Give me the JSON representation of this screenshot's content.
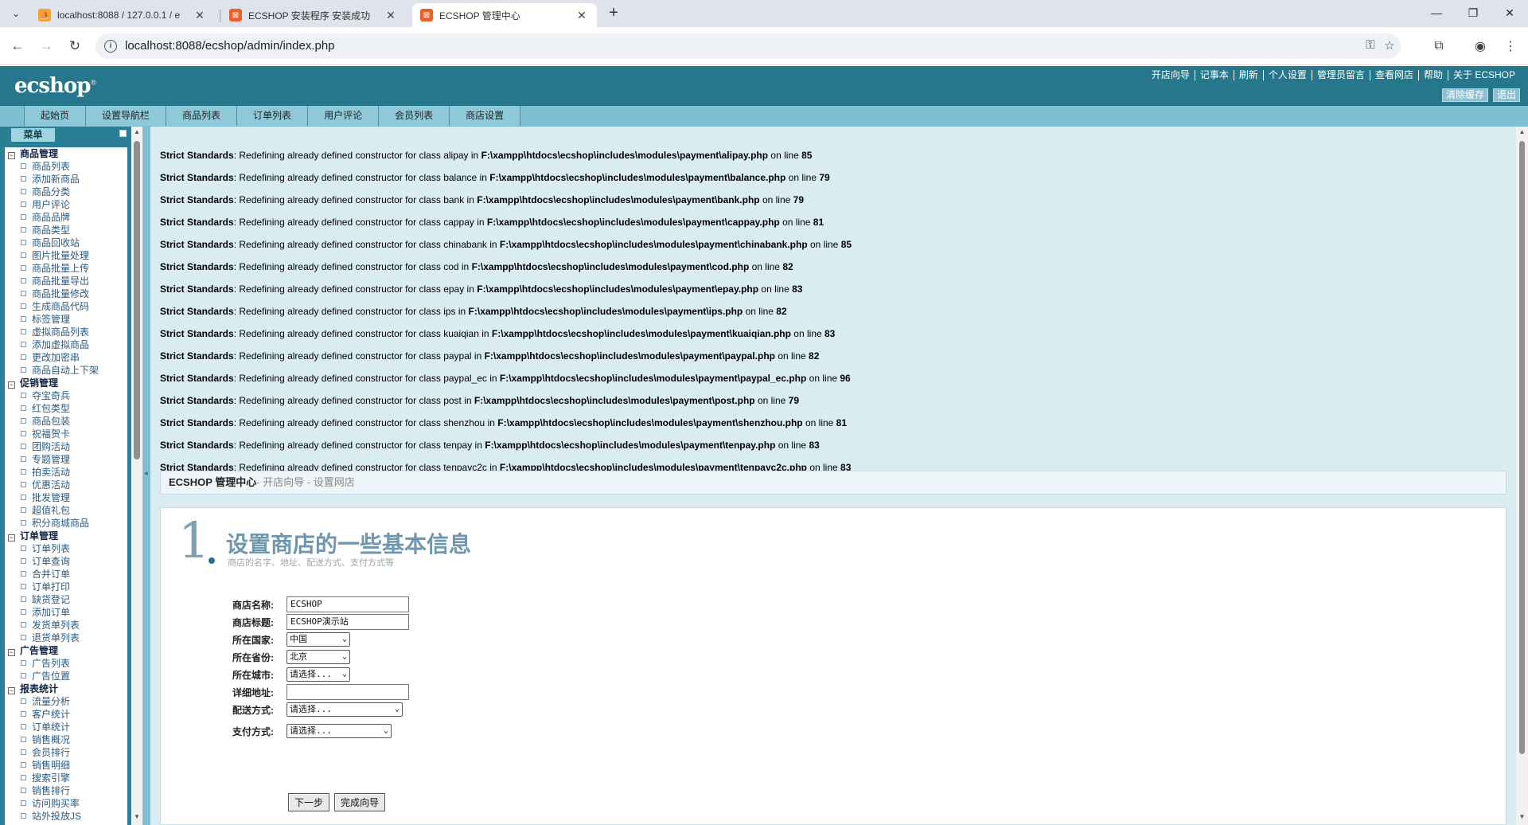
{
  "browser": {
    "tabs": [
      {
        "title": "localhost:8088 / 127.0.0.1 / e",
        "active": false
      },
      {
        "title": "ECSHOP 安装程序 安装成功",
        "active": false
      },
      {
        "title": "ECSHOP 管理中心",
        "active": true
      }
    ],
    "url": "localhost:8088/ecshop/admin/index.php"
  },
  "header": {
    "logo": "ecshop",
    "links": [
      "开店向导",
      "记事本",
      "刷新",
      "个人设置",
      "管理员留言",
      "查看网店",
      "帮助",
      "关于 ECSHOP"
    ],
    "buttons": [
      "清除缓存",
      "退出"
    ]
  },
  "nav": {
    "tabs": [
      "起始页",
      "设置导航栏",
      "商品列表",
      "订单列表",
      "用户评论",
      "会员列表",
      "商店设置"
    ]
  },
  "menu": {
    "title": "菜单",
    "groups": [
      {
        "name": "商品管理",
        "items": [
          "商品列表",
          "添加新商品",
          "商品分类",
          "用户评论",
          "商品品牌",
          "商品类型",
          "商品回收站",
          "图片批量处理",
          "商品批量上传",
          "商品批量导出",
          "商品批量修改",
          "生成商品代码",
          "标签管理",
          "虚拟商品列表",
          "添加虚拟商品",
          "更改加密串",
          "商品自动上下架"
        ]
      },
      {
        "name": "促销管理",
        "items": [
          "夺宝奇兵",
          "红包类型",
          "商品包装",
          "祝福贺卡",
          "团购活动",
          "专题管理",
          "拍卖活动",
          "优惠活动",
          "批发管理",
          "超值礼包",
          "积分商城商品"
        ]
      },
      {
        "name": "订单管理",
        "items": [
          "订单列表",
          "订单查询",
          "合并订单",
          "订单打印",
          "缺货登记",
          "添加订单",
          "发货单列表",
          "退货单列表"
        ]
      },
      {
        "name": "广告管理",
        "items": [
          "广告列表",
          "广告位置"
        ]
      },
      {
        "name": "报表统计",
        "items": [
          "流量分析",
          "客户统计",
          "订单统计",
          "销售概况",
          "会员排行",
          "销售明细",
          "搜索引擎",
          "销售排行",
          "访问购买率",
          "站外投放JS"
        ]
      }
    ]
  },
  "warnings": {
    "label": "Strict Standards",
    "middle": ": Redefining already defined constructor for class ",
    "in": " in ",
    "online": " on line ",
    "rows": [
      {
        "cls": "alipay",
        "file": "F:\\xampp\\htdocs\\ecshop\\includes\\modules\\payment\\alipay.php",
        "line": "85"
      },
      {
        "cls": "balance",
        "file": "F:\\xampp\\htdocs\\ecshop\\includes\\modules\\payment\\balance.php",
        "line": "79"
      },
      {
        "cls": "bank",
        "file": "F:\\xampp\\htdocs\\ecshop\\includes\\modules\\payment\\bank.php",
        "line": "79"
      },
      {
        "cls": "cappay",
        "file": "F:\\xampp\\htdocs\\ecshop\\includes\\modules\\payment\\cappay.php",
        "line": "81"
      },
      {
        "cls": "chinabank",
        "file": "F:\\xampp\\htdocs\\ecshop\\includes\\modules\\payment\\chinabank.php",
        "line": "85"
      },
      {
        "cls": "cod",
        "file": "F:\\xampp\\htdocs\\ecshop\\includes\\modules\\payment\\cod.php",
        "line": "82"
      },
      {
        "cls": "epay",
        "file": "F:\\xampp\\htdocs\\ecshop\\includes\\modules\\payment\\epay.php",
        "line": "83"
      },
      {
        "cls": "ips",
        "file": "F:\\xampp\\htdocs\\ecshop\\includes\\modules\\payment\\ips.php",
        "line": "82"
      },
      {
        "cls": "kuaiqian",
        "file": "F:\\xampp\\htdocs\\ecshop\\includes\\modules\\payment\\kuaiqian.php",
        "line": "83"
      },
      {
        "cls": "paypal",
        "file": "F:\\xampp\\htdocs\\ecshop\\includes\\modules\\payment\\paypal.php",
        "line": "82"
      },
      {
        "cls": "paypal_ec",
        "file": "F:\\xampp\\htdocs\\ecshop\\includes\\modules\\payment\\paypal_ec.php",
        "line": "96"
      },
      {
        "cls": "post",
        "file": "F:\\xampp\\htdocs\\ecshop\\includes\\modules\\payment\\post.php",
        "line": "79"
      },
      {
        "cls": "shenzhou",
        "file": "F:\\xampp\\htdocs\\ecshop\\includes\\modules\\payment\\shenzhou.php",
        "line": "81"
      },
      {
        "cls": "tenpay",
        "file": "F:\\xampp\\htdocs\\ecshop\\includes\\modules\\payment\\tenpay.php",
        "line": "83"
      },
      {
        "cls": "tenpayc2c",
        "file": "F:\\xampp\\htdocs\\ecshop\\includes\\modules\\payment\\tenpayc2c.php",
        "line": "83"
      }
    ]
  },
  "breadcrumb": {
    "title": "ECSHOP 管理中心",
    "sub": "- 开店向导 - 设置网店"
  },
  "step": {
    "number": "1",
    "title": "设置商店的一些基本信息",
    "subtitle": "商店的名字、地址、配送方式、支付方式等"
  },
  "form": {
    "shop_name_label": "商店名称:",
    "shop_name_value": "ECSHOP",
    "shop_title_label": "商店标题:",
    "shop_title_value": "ECSHOP演示站",
    "country_label": "所在国家:",
    "country_value": "中国",
    "province_label": "所在省份:",
    "province_value": "北京",
    "city_label": "所在城市:",
    "city_value": "请选择...",
    "address_label": "详细地址:",
    "address_value": "",
    "shipping_label": "配送方式:",
    "shipping_value": "请选择...",
    "payment_label": "支付方式:",
    "payment_value": "请选择...",
    "next_button": "下一步",
    "finish_button": "完成向导"
  }
}
